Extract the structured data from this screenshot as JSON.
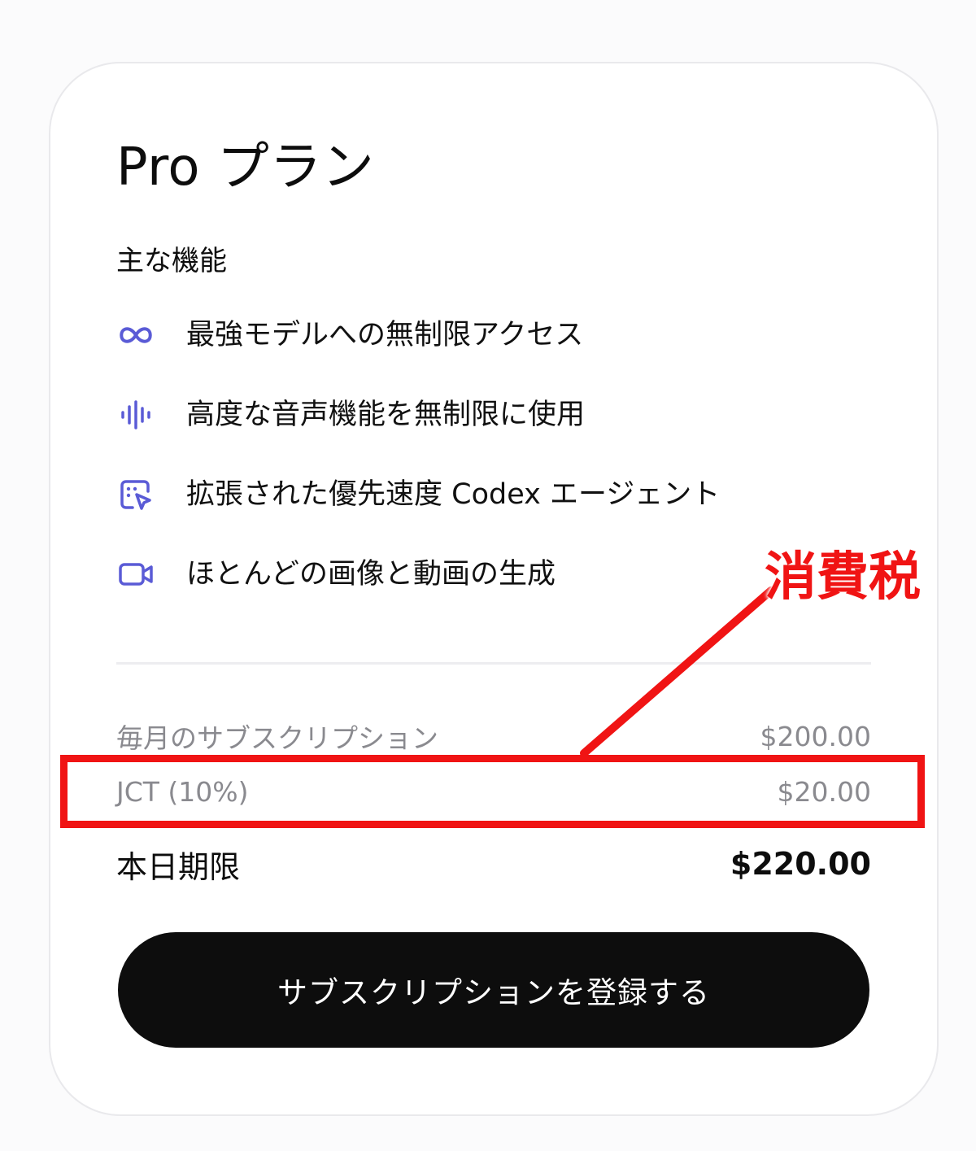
{
  "plan": {
    "title": "Pro プラン",
    "features_heading": "主な機能",
    "features": [
      {
        "icon": "infinity-icon",
        "label": "最強モデルへの無制限アクセス"
      },
      {
        "icon": "voice-waveform-icon",
        "label": "高度な音声機能を無制限に使用"
      },
      {
        "icon": "codex-agent-icon",
        "label": "拡張された優先速度 Codex エージェント"
      },
      {
        "icon": "video-camera-icon",
        "label": "ほとんどの画像と動画の生成"
      }
    ]
  },
  "billing": {
    "monthly_label": "毎月のサブスクリプション",
    "monthly_amount": "$200.00",
    "tax_label": "JCT (10%)",
    "tax_amount": "$20.00",
    "due_label": "本日期限",
    "due_amount": "$220.00"
  },
  "action": {
    "subscribe_label": "サブスクリプションを登録する"
  },
  "annotation": {
    "label": "消費税",
    "color": "#f01414"
  },
  "colors": {
    "icon_accent": "#5a5bd6",
    "button_bg": "#0d0d0d",
    "muted_text": "#8a8a8f"
  }
}
